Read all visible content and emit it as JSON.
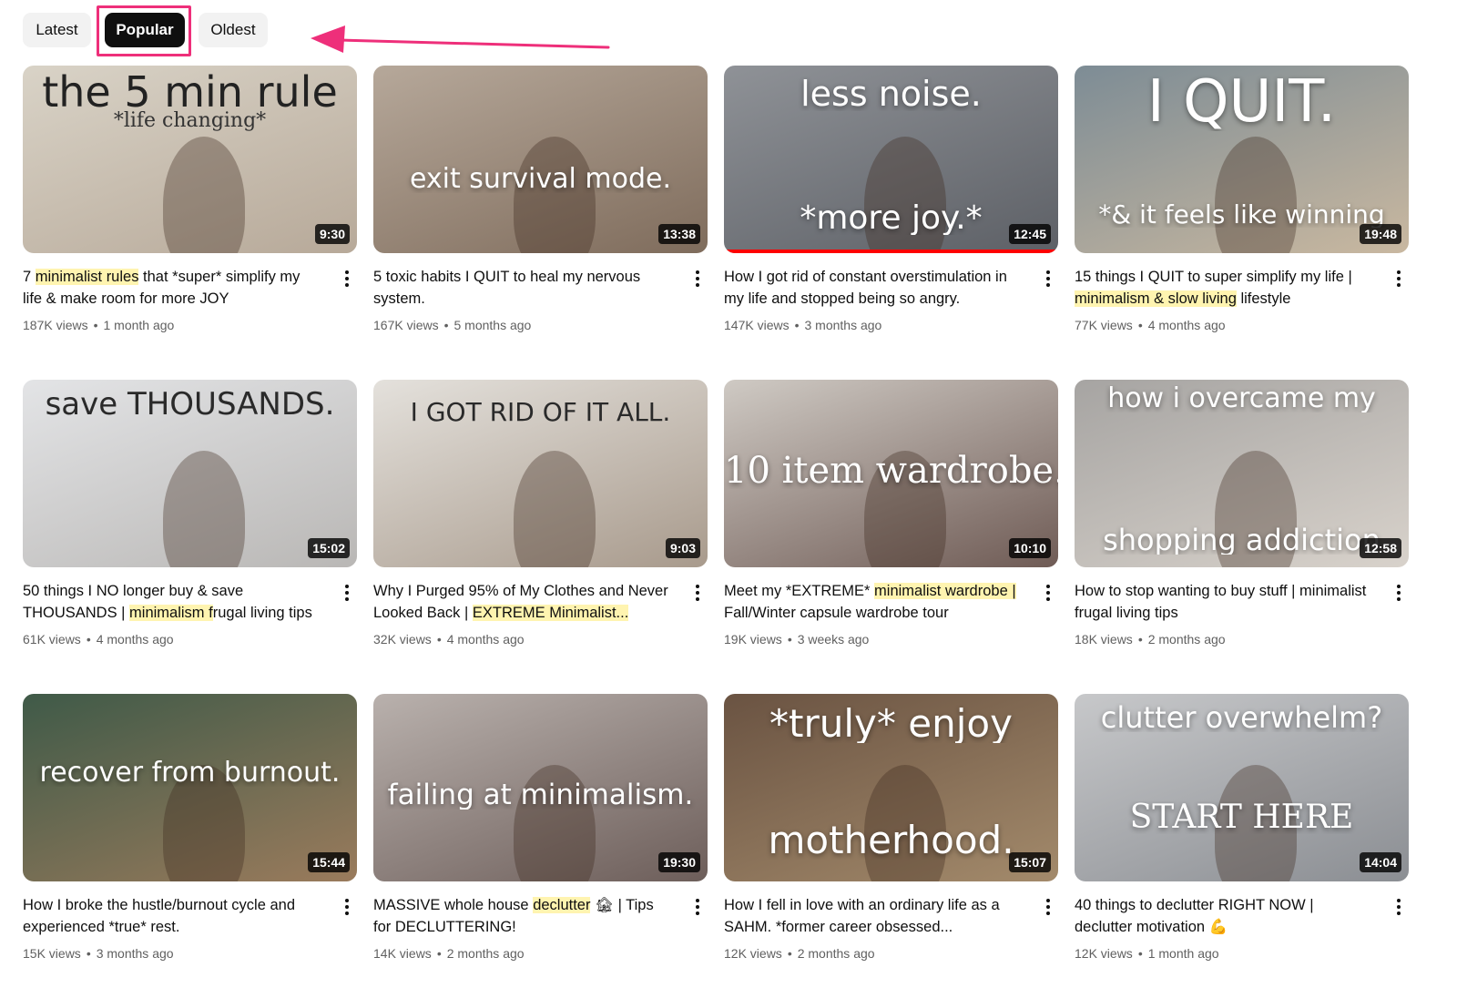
{
  "filters": {
    "chips": [
      "Latest",
      "Popular",
      "Oldest"
    ],
    "active": "Popular"
  },
  "accent": "#ee2f7a",
  "videos": [
    {
      "thumb_text": [
        "the 5 min rule",
        "*life changing*"
      ],
      "duration": "9:30",
      "title_parts": [
        {
          "t": "7 "
        },
        {
          "t": "minimalist rules",
          "hl": true
        },
        {
          "t": " that *super* simplify my life & make room for more JOY"
        }
      ],
      "views": "187K views",
      "age": "1 month ago",
      "bg": [
        "#d9d3c7",
        "#b7a999"
      ]
    },
    {
      "thumb_text": [
        "exit survival mode."
      ],
      "duration": "13:38",
      "title_parts": [
        {
          "t": "5 toxic habits I QUIT to heal my nervous system."
        }
      ],
      "views": "167K views",
      "age": "5 months ago",
      "bg": [
        "#b6a89a",
        "#7f6c5c"
      ]
    },
    {
      "thumb_text": [
        "less noise.",
        "*more joy.*"
      ],
      "duration": "12:45",
      "title_parts": [
        {
          "t": "How I got rid of constant overstimulation in my life and stopped being so angry."
        }
      ],
      "views": "147K views",
      "age": "3 months ago",
      "bg": [
        "#8f9297",
        "#5d6066"
      ],
      "progress": 1.0
    },
    {
      "thumb_text": [
        "I QUIT.",
        "*& it feels like winning"
      ],
      "duration": "19:48",
      "title_parts": [
        {
          "t": "15 things I QUIT to super simplify my life | "
        },
        {
          "t": "minimalism & slow living",
          "hl": true
        },
        {
          "t": " lifestyle"
        }
      ],
      "views": "77K views",
      "age": "4 months ago",
      "bg": [
        "#7d8c95",
        "#c9b8a0"
      ]
    },
    {
      "thumb_text": [
        "save THOUSANDS."
      ],
      "duration": "15:02",
      "title_parts": [
        {
          "t": "50 things I NO longer buy & save THOUSANDS | "
        },
        {
          "t": "minimalism f",
          "hl": true
        },
        {
          "t": "rugal living tips"
        }
      ],
      "views": "61K views",
      "age": "4 months ago",
      "bg": [
        "#e3e4e6",
        "#b9b7b5"
      ]
    },
    {
      "thumb_text": [
        "I GOT RID OF IT ALL."
      ],
      "duration": "9:03",
      "title_parts": [
        {
          "t": "Why I Purged 95% of My Clothes and Never Looked Back | "
        },
        {
          "t": "EXTREME Minimalist...",
          "hl": true
        }
      ],
      "views": "32K views",
      "age": "4 months ago",
      "bg": [
        "#e4e1dc",
        "#a89a8c"
      ]
    },
    {
      "thumb_text": [
        "10 item wardrobe."
      ],
      "duration": "10:10",
      "title_parts": [
        {
          "t": "Meet my *EXTREME* "
        },
        {
          "t": "minimalist wardrobe |",
          "hl": true
        },
        {
          "t": " Fall/Winter capsule wardrobe tour"
        }
      ],
      "views": "19K views",
      "age": "3 weeks ago",
      "bg": [
        "#cfcac4",
        "#6f5b55"
      ]
    },
    {
      "thumb_text": [
        "how i overcame my",
        "shopping addiction"
      ],
      "duration": "12:58",
      "title_parts": [
        {
          "t": "How to stop wanting to buy stuff | minimalist frugal living tips"
        }
      ],
      "views": "18K views",
      "age": "2 months ago",
      "bg": [
        "#a6a4a2",
        "#d8d2cb"
      ]
    },
    {
      "thumb_text": [
        "recover from burnout."
      ],
      "duration": "15:44",
      "title_parts": [
        {
          "t": "How I broke the hustle/burnout cycle and experienced *true* rest."
        }
      ],
      "views": "15K views",
      "age": "3 months ago",
      "bg": [
        "#3f5a48",
        "#9a7b5c"
      ]
    },
    {
      "thumb_text": [
        "failing at minimalism."
      ],
      "duration": "19:30",
      "title_parts": [
        {
          "t": "MASSIVE whole house "
        },
        {
          "t": "declutter",
          "hl": true
        },
        {
          "t": " 🏚 | Tips for DECLUTTERING!"
        }
      ],
      "views": "14K views",
      "age": "2 months ago",
      "bg": [
        "#b9b1ad",
        "#6d5e5a"
      ]
    },
    {
      "thumb_text": [
        "*truly* enjoy",
        "motherhood."
      ],
      "duration": "15:07",
      "title_parts": [
        {
          "t": "How I fell in love with an ordinary life as a SAHM. *former career obsessed..."
        }
      ],
      "views": "12K views",
      "age": "2 months ago",
      "bg": [
        "#6a5342",
        "#a38a6b"
      ]
    },
    {
      "thumb_text": [
        "clutter overwhelm?",
        "START HERE"
      ],
      "duration": "14:04",
      "title_parts": [
        {
          "t": "40 things to declutter RIGHT NOW | declutter motivation 💪"
        }
      ],
      "views": "12K views",
      "age": "1 month ago",
      "bg": [
        "#c7c8ca",
        "#8b8e93"
      ]
    }
  ]
}
